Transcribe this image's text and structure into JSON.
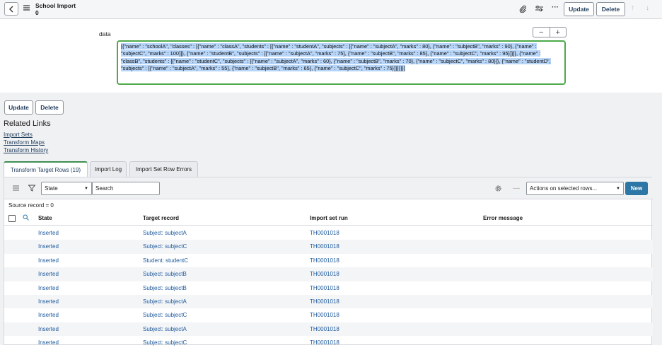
{
  "header": {
    "title": "School Import",
    "subtitle": "0",
    "update_label": "Update",
    "delete_label": "Delete"
  },
  "form": {
    "field_label": "data",
    "data_value_part1": "[{\"name\" : \"schoolA\", \"classes\" : [{\"name\" : \"classA\", \"students\" : [{\"name\" : \"studentA\", \"subjects\" : [{\"name\" : \"subjectA\", \"marks\" : 80}, {\"name\" : \"subjectB\", \"marks\" : 90}, {\"name\" : \"subjectC\", \"marks\" : 100}]}, {\"name\" : \"studentB\", \"subjects\" : [{\"name\" : \"subjectA\", \"marks\" : 75}, {\"name\" : \"subjectB\", \"marks\" : 85}, {\"name\" : \"subjectC\", \"marks\" : 95}]}]}, {\"name\" : \"classB\", \"students\" : [{\"name\" : \"studentC\", \"subjects\" : [{\"name\" : \"subjectA\", \"marks\" : 60}, {\"name\" : \"subjectB\", \"marks\" : 70}, {\"name\" : \"subjectC\", \"marks\" : 80}]}, {\"name\" : \"studentD\", \"subjects\" : [{\"name\" : \"subjectA\", \"marks\" : 55}, {\"name\" : \"subjectB\", \"marks\" : 65}, {\"name\" : \"subjectC\", \"marks\" : 75}]}]}]}]"
  },
  "actions": {
    "update_label": "Update",
    "delete_label": "Delete"
  },
  "related": {
    "title": "Related Links",
    "links": [
      "Import Sets",
      "Transform Maps",
      "Transform History"
    ]
  },
  "tabs": [
    {
      "label": "Transform Target Rows (19)"
    },
    {
      "label": "Import Log"
    },
    {
      "label": "Import Set Row Errors"
    }
  ],
  "toolbar": {
    "filter_field": "State",
    "search_placeholder": "Search",
    "actions_label": "Actions on selected rows...",
    "new_label": "New"
  },
  "list": {
    "breadcrumb": "Source record = 0",
    "columns": [
      "State",
      "Target record",
      "Import set run",
      "Error message"
    ],
    "rows": [
      {
        "state": "Inserted",
        "target": "Subject: subjectA",
        "run": "TH0001018",
        "error": ""
      },
      {
        "state": "Inserted",
        "target": "Subject: subjectC",
        "run": "TH0001018",
        "error": ""
      },
      {
        "state": "Inserted",
        "target": "Student: studentC",
        "run": "TH0001018",
        "error": ""
      },
      {
        "state": "Inserted",
        "target": "Subject: subjectB",
        "run": "TH0001018",
        "error": ""
      },
      {
        "state": "Inserted",
        "target": "Subject: subjectB",
        "run": "TH0001018",
        "error": ""
      },
      {
        "state": "Inserted",
        "target": "Subject: subjectA",
        "run": "TH0001018",
        "error": ""
      },
      {
        "state": "Inserted",
        "target": "Subject: subjectC",
        "run": "TH0001018",
        "error": ""
      },
      {
        "state": "Inserted",
        "target": "Subject: subjectA",
        "run": "TH0001018",
        "error": ""
      },
      {
        "state": "Inserted",
        "target": "Subject: subjectC",
        "run": "TH0001018",
        "error": ""
      }
    ]
  }
}
